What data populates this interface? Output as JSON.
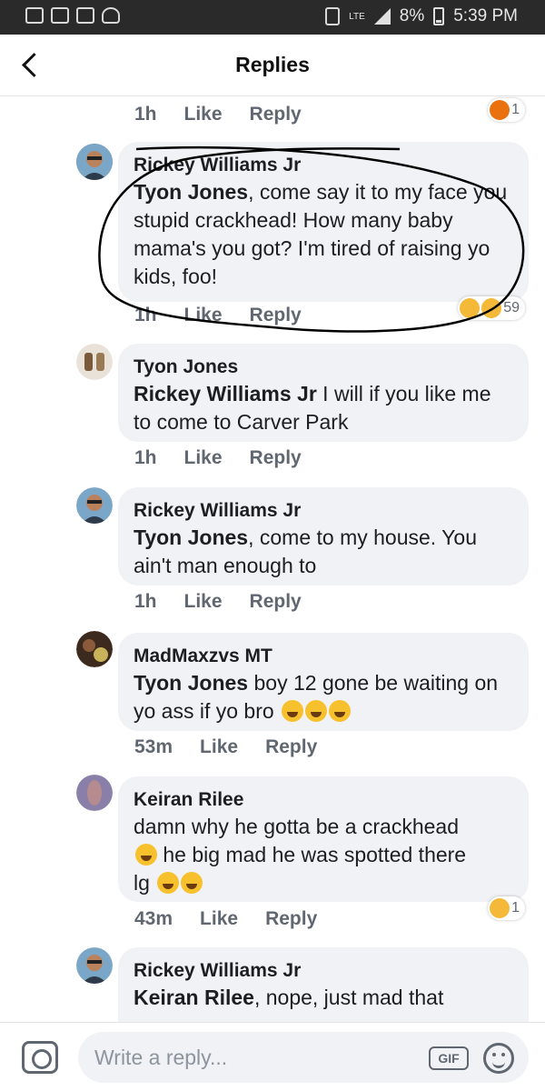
{
  "status_bar": {
    "battery": "8%",
    "time": "5:39 PM",
    "network": "LTE"
  },
  "header": {
    "title": "Replies"
  },
  "top_meta": {
    "time": "1h",
    "like": "Like",
    "reply": "Reply",
    "reactions_count": "1"
  },
  "replies": [
    {
      "author": "Rickey Williams Jr",
      "mention": "Tyon Jones",
      "text": ", come say it to my face you stupid crackhead!  How many baby mama's you got?  I'm tired of raising yo kids, foo!",
      "time": "1h",
      "like": "Like",
      "reply": "Reply",
      "reactions_count": "59"
    },
    {
      "author": "Tyon Jones",
      "mention": "Rickey Williams Jr",
      "text": " I will if you like me to come to Carver Park",
      "time": "1h",
      "like": "Like",
      "reply": "Reply"
    },
    {
      "author": "Rickey Williams Jr",
      "mention": "Tyon Jones",
      "text": ", come to my house.  You ain't man enough to",
      "time": "1h",
      "like": "Like",
      "reply": "Reply"
    },
    {
      "author": "MadMaxzvs MT",
      "mention": "Tyon Jones",
      "text": "  boy 12 gone be waiting on yo ass if yo bro ",
      "time": "53m",
      "like": "Like",
      "reply": "Reply"
    },
    {
      "author": "Keiran Rilee",
      "text_a": "damn why he gotta be a crackhead",
      "text_b": " he big mad he was spotted there",
      "text_c": "lg ",
      "time": "43m",
      "like": "Like",
      "reply": "Reply",
      "reactions_count": "1"
    },
    {
      "author": "Rickey Williams Jr",
      "mention": "Keiran Rilee",
      "text": ", nope, just mad that"
    }
  ],
  "composer": {
    "placeholder": "Write a reply...",
    "gif_label": "GIF"
  },
  "colors": {
    "bubble": "#f0f2f5",
    "meta": "#606770",
    "statusbar": "#2a2a2a"
  }
}
